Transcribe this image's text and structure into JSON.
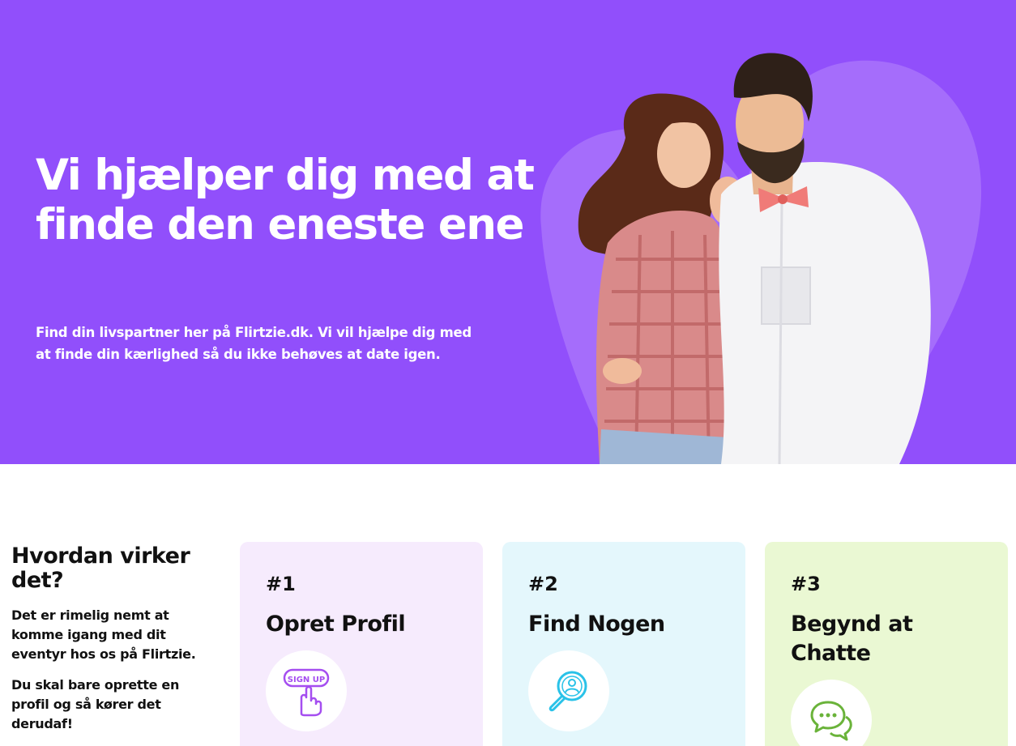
{
  "hero": {
    "title": "Vi hjælper dig med at finde den eneste ene",
    "subtitle": "Find din livspartner her på Flirtzie.dk. Vi vil hjælpe dig med at finde din kærlighed så du ikke behøves at date igen.",
    "image": "couple-photo",
    "background_color": "#914ffb"
  },
  "how": {
    "title": "Hvordan virker det?",
    "paragraph1": "Det er rimelig nemt at komme igang med dit eventyr hos os på Flirtzie.",
    "paragraph2": "Du skal bare oprette en profil og så kører det derudaf!"
  },
  "steps": [
    {
      "number": "#1",
      "title": "Opret Profil",
      "icon": "sign-up-icon",
      "icon_text": "SIGN UP",
      "color": "#f6ebfd"
    },
    {
      "number": "#2",
      "title": "Find Nogen",
      "icon": "search-person-icon",
      "color": "#e4f7fc"
    },
    {
      "number": "#3",
      "title": "Begynd at Chatte",
      "icon": "chat-bubbles-icon",
      "color": "#eaf8d3"
    }
  ]
}
